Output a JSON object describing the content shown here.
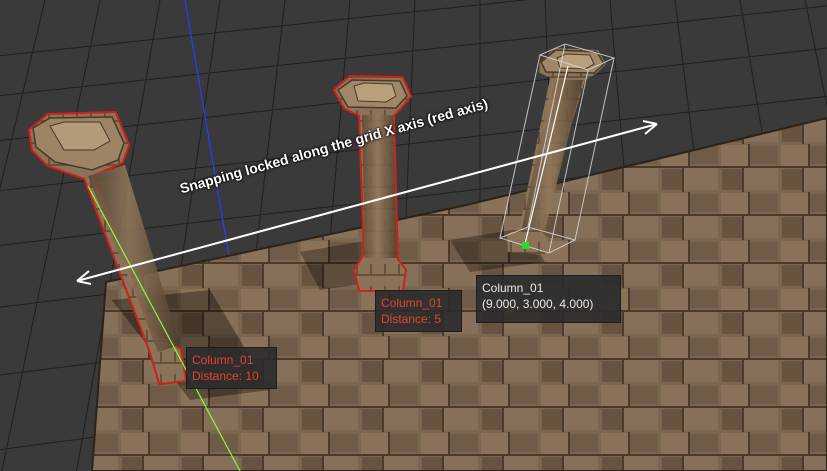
{
  "viewport": {
    "annotation": "Snapping locked along the grid X axis (red axis)"
  },
  "objects": [
    {
      "name": "Column_01",
      "detail": "Distance: 10",
      "state": "snap-target"
    },
    {
      "name": "Column_01",
      "detail": "Distance: 5",
      "state": "snap-target"
    },
    {
      "name": "Column_01",
      "detail": "(9.000, 3.000, 4.000)",
      "state": "selected"
    }
  ],
  "colors": {
    "grid_background": "#3a3a3a",
    "grid_line": "#1f1f1f",
    "floor": "#7a6650",
    "outline_red": "#d0201a",
    "label_red": "#e0452f",
    "x_axis_guide": "#7dff3a",
    "y_axis_line": "#2a3cff",
    "pivot_green": "#22e022",
    "pivot_orange": "#f5a01a",
    "arrow": "#ffffff"
  }
}
